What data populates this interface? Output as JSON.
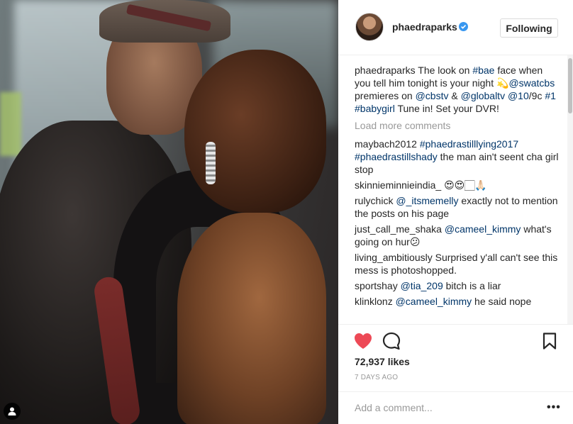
{
  "post": {
    "username": "phaedraparks",
    "follow_label": "Following",
    "caption": {
      "user": "phaedraparks",
      "parts": [
        {
          "t": " The look on "
        },
        {
          "t": "#bae",
          "tag": true
        },
        {
          "t": " face when you tell him tonight is your night 💫"
        },
        {
          "t": "@swatcbs",
          "tag": true
        },
        {
          "t": " premieres on "
        },
        {
          "t": "@cbstv",
          "tag": true
        },
        {
          "t": " & "
        },
        {
          "t": "@globaltv",
          "tag": true
        },
        {
          "t": " "
        },
        {
          "t": "@10",
          "tag": true
        },
        {
          "t": "/9c "
        },
        {
          "t": "#1",
          "tag": true
        },
        {
          "t": " "
        },
        {
          "t": "#babygirl",
          "tag": true
        },
        {
          "t": " Tune in! Set your DVR!"
        }
      ]
    },
    "load_more": "Load more comments",
    "comments": [
      {
        "user": "maybach2012",
        "parts": [
          {
            "t": " "
          },
          {
            "t": "#phaedrastilllying2017",
            "tag": true
          },
          {
            "t": " "
          },
          {
            "t": "#phaedrastillshady",
            "tag": true
          },
          {
            "t": " the man ain't seent cha girl stop"
          }
        ]
      },
      {
        "user": "skinnieminnieindia_",
        "parts": [
          {
            "t": " 😍😍🏻🙏🏻"
          }
        ]
      },
      {
        "user": "rulychick",
        "parts": [
          {
            "t": " "
          },
          {
            "t": "@_itsmemelly",
            "tag": true
          },
          {
            "t": " exactly not to mention the posts on his page"
          }
        ]
      },
      {
        "user": "just_call_me_shaka",
        "parts": [
          {
            "t": " "
          },
          {
            "t": "@cameel_kimmy",
            "tag": true
          },
          {
            "t": " what's going on hur😕"
          }
        ]
      },
      {
        "user": "living_ambitiously",
        "parts": [
          {
            "t": " Surprised y'all can't see this mess is photoshopped."
          }
        ]
      },
      {
        "user": "sportshay",
        "parts": [
          {
            "t": " "
          },
          {
            "t": "@tia_209",
            "tag": true
          },
          {
            "t": " bitch is a liar"
          }
        ]
      },
      {
        "user": "klinklonz",
        "parts": [
          {
            "t": " "
          },
          {
            "t": "@cameel_kimmy",
            "tag": true
          },
          {
            "t": " he said nope"
          }
        ]
      }
    ],
    "likes": "72,937 likes",
    "timestamp": "7 DAYS AGO",
    "add_comment_placeholder": "Add a comment...",
    "more_label": "•••",
    "icons": {
      "like": "heart-filled-icon",
      "comment": "speech-bubble-icon",
      "save": "bookmark-icon",
      "tagged_user": "user-tag-icon",
      "verified": "verified-badge-icon"
    },
    "colors": {
      "like_red": "#ed4956",
      "verified_blue": "#3897f0",
      "link_blue": "#003569",
      "muted": "#999999"
    }
  }
}
